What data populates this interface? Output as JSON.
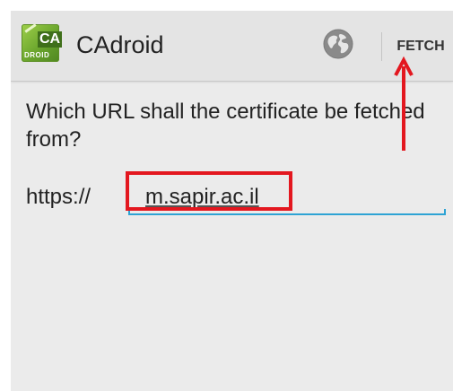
{
  "action_bar": {
    "app_icon": {
      "label_top": "CA",
      "label_bottom": "DROID"
    },
    "title": "CAdroid",
    "globe_icon": "globe-icon",
    "fetch_label": "FETCH"
  },
  "content": {
    "question": "Which URL shall the certificate be fetched from?",
    "url_prefix": "https://",
    "url_value": "m.sapir.ac.il"
  },
  "colors": {
    "accent_underline": "#2ea3d4",
    "annotation_red": "#e3171f",
    "icon_green": "#6aa52d"
  },
  "annotations": {
    "highlight_target": "url-input",
    "arrow_target": "fetch-button"
  }
}
